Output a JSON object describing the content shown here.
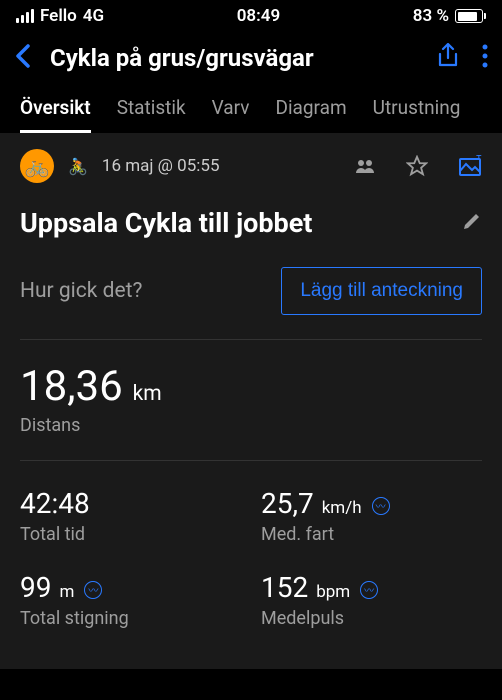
{
  "status": {
    "carrier": "Fello",
    "network": "4G",
    "time": "08:49",
    "battery": "83 %"
  },
  "header": {
    "title": "Cykla på grus/grusvägar"
  },
  "tabs": [
    "Översikt",
    "Statistik",
    "Varv",
    "Diagram",
    "Utrustning"
  ],
  "activity": {
    "datetime": "16 maj @ 05:55",
    "title": "Uppsala Cykla till jobbet",
    "note_prompt": "Hur gick det?",
    "note_button": "Lägg till anteckning"
  },
  "primary": {
    "value": "18,36",
    "unit": "km",
    "label": "Distans"
  },
  "stats": [
    {
      "value": "42:48",
      "unit": "",
      "label": "Total tid",
      "info": false
    },
    {
      "value": "25,7",
      "unit": "km/h",
      "label": "Med. fart",
      "info": true
    },
    {
      "value": "99",
      "unit": "m",
      "label": "Total stigning",
      "info": true
    },
    {
      "value": "152",
      "unit": "bpm",
      "label": "Medelpuls",
      "info": true
    }
  ]
}
